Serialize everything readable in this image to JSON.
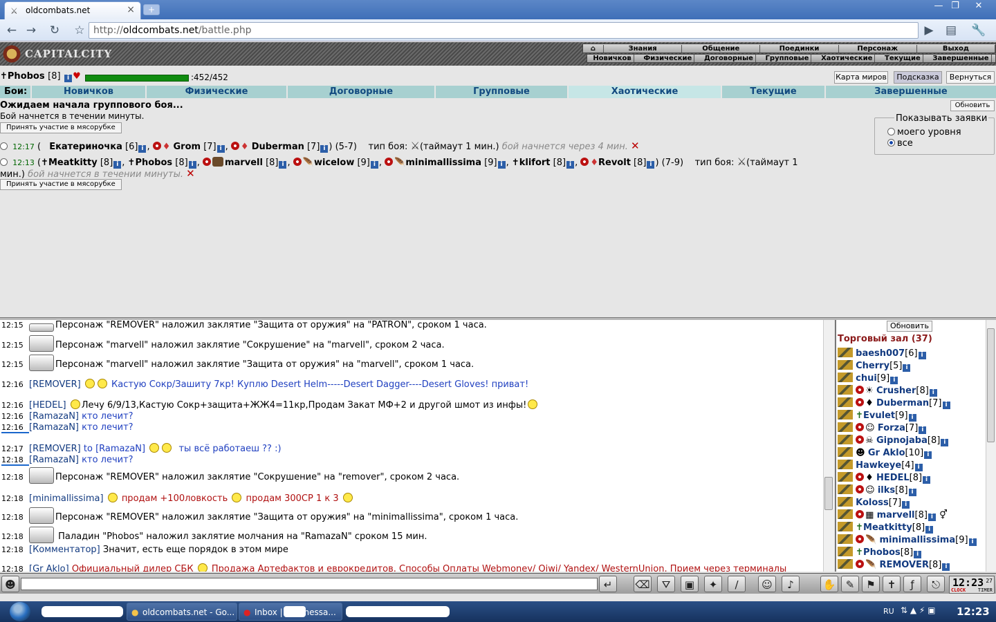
{
  "browser": {
    "tab_title": "oldcombats.net",
    "url_prefix": "http://",
    "url_host": "oldcombats.net",
    "url_path": "/battle.php"
  },
  "game_header": {
    "logo": "CAPITALCITY",
    "menu_top": [
      "Знания",
      "Общение",
      "Поединки",
      "Персонаж",
      "Выход"
    ],
    "menu_sub": [
      "Новичков",
      "Физические",
      "Договорные",
      "Групповые",
      "Хаотические",
      "Текущие",
      "Завершенные"
    ]
  },
  "player": {
    "name": "Phobos",
    "level": "[8]",
    "hp": ":452/452",
    "hp_fraction": 1.0,
    "buttons": [
      "Карта миров",
      "Подсказка",
      "Вернуться"
    ]
  },
  "battle_tabs": {
    "label": "Бои:",
    "tabs": [
      "Новичков",
      "Физические",
      "Договорные",
      "Групповые",
      "Хаотические",
      "Текущие",
      "Завершенные"
    ],
    "active": "Хаотические"
  },
  "battle": {
    "waiting": "Ожидаем начала группового боя...",
    "starts": "Бой начнется в течении минуты.",
    "join_label": "Принять участие в мясорубке",
    "refresh_label": "Обновить",
    "show_title": "Показывать заявки",
    "show_opt1": "моего уровня",
    "show_opt2": "все",
    "row1": {
      "time": "12:17",
      "p1": "Екатериночка",
      "p1l": "[6]",
      "p2": "Grom",
      "p2l": "[7]",
      "p3": "Duberman",
      "p3l": "[7]",
      "range": ") (5-7)",
      "type_label": "тип боя:",
      "timeout": "(таймаут 1 мин.)",
      "starts": "бой начнется через 4 мин."
    },
    "row2": {
      "time": "12:13",
      "players": [
        {
          "name": "Meatkitty",
          "lvl": "[8]"
        },
        {
          "name": "Phobos",
          "lvl": "[8]"
        },
        {
          "name": "marvell",
          "lvl": "[8]"
        },
        {
          "name": "wicelow",
          "lvl": "[9]"
        },
        {
          "name": "minimallissima",
          "lvl": "[9]"
        },
        {
          "name": "klifort",
          "lvl": "[8]"
        },
        {
          "name": "Revolt",
          "lvl": "[8]"
        }
      ],
      "range": ") (7-9)",
      "type_label": "тип боя:",
      "timeout": "(таймаут 1",
      "timeout2": "мин.)",
      "starts": "бой начнется в течении минуты."
    }
  },
  "chat": [
    {
      "t": "12:15",
      "text": "Персонаж \"REMOVER\" наложил заклятие \"Защита от оружия\" на \"PATRON\", сроком 1 часа."
    },
    {
      "t": "12:15",
      "text": "Персонаж \"marvell\" наложил заклятие \"Сокрушение\" на \"marvell\", сроком 2 часа."
    },
    {
      "t": "12:15",
      "text": "Персонаж \"marvell\" наложил заклятие \"Защита от оружия\" на \"marvell\", сроком 1 часа."
    },
    {
      "t": "12:16",
      "nick": "[REMOVER]",
      "text": "Кастую Сокр/Зашиту 7кр! Куплю Desert Helm-----Desert Dagger----Desert Gloves! приват!"
    },
    {
      "t": "12:16",
      "nick": "[HEDEL]",
      "text": "Лечу 6/9/13,Кастую Сокр+защита+ЖЖ4=11кр,Продам Закат МФ+2 и другой шмот из инфы!"
    },
    {
      "t": "12:16",
      "nick": "[RamazaN]",
      "text": "кто лечит?"
    },
    {
      "t": "12:16",
      "nick": "[RamazaN]",
      "text": "кто лечит?"
    },
    {
      "t": "12:17",
      "nick": "[REMOVER]",
      "to": "to [RamazaN]",
      "text": "ты всё работаеш ?? :)"
    },
    {
      "t": "12:18",
      "nick": "[RamazaN]",
      "text": "кто лечит?"
    },
    {
      "t": "12:18",
      "text": "Персонаж \"REMOVER\" наложил заклятие \"Сокрушение\" на \"remover\", сроком 2 часа."
    },
    {
      "t": "12:18",
      "nick": "[minimallissima]",
      "text1": "продам +100ловкость",
      "text2": "продам 300СР 1 к 3"
    },
    {
      "t": "12:18",
      "text": "Персонаж \"REMOVER\" наложил заклятие \"Защита от оружия\" на \"minimallissima\", сроком 1 часа."
    },
    {
      "t": "12:18",
      "text": "Паладин \"Phobos\" наложил заклятие молчания на \"RamazaN\" сроком 15 мин."
    },
    {
      "t": "12:18",
      "nick": "[Комментатор]",
      "text": "Значит, есть еще порядок в этом мире"
    },
    {
      "t": "12:18",
      "nick": "[Gr Aklo]",
      "text1": "Официальный дилер СБК",
      "text2": "Продажа Артефактов и еврокредитов. Способы Оплаты Webmoney/ Qiwi/ Yandex/ WesternUnion. Прием через терминалы"
    }
  ],
  "room": {
    "refresh": "Обновить",
    "title": "Торговый зал (37)",
    "users": [
      {
        "name": "baesh007",
        "lvl": "[6]"
      },
      {
        "name": "Cherry",
        "lvl": "[5]"
      },
      {
        "name": "chui",
        "lvl": "[9]"
      },
      {
        "name": "Crusher",
        "lvl": "[8]"
      },
      {
        "name": "Duberman",
        "lvl": "[7]"
      },
      {
        "name": "Evulet",
        "lvl": "[9]"
      },
      {
        "name": "Forza",
        "lvl": "[7]"
      },
      {
        "name": "Gipnojaba",
        "lvl": "[8]"
      },
      {
        "name": "Gr Aklo",
        "lvl": "[10]"
      },
      {
        "name": "Hawkeye",
        "lvl": "[4]"
      },
      {
        "name": "HEDEL",
        "lvl": "[8]"
      },
      {
        "name": "ilks",
        "lvl": "[8]"
      },
      {
        "name": "Koloss",
        "lvl": "[7]"
      },
      {
        "name": "marvell",
        "lvl": "[8]"
      },
      {
        "name": "Meatkitty",
        "lvl": "[8]"
      },
      {
        "name": "minimallissima",
        "lvl": "[9]"
      },
      {
        "name": "Phobos",
        "lvl": "[8]"
      },
      {
        "name": "REMOVER",
        "lvl": "[8]"
      }
    ]
  },
  "bottom": {
    "clock": "12:23",
    "clock_sec": "27",
    "clock_label": "CLOCK",
    "timer_label": "TIMER"
  },
  "taskbar": {
    "items": [
      "oldcombats.net - Go...",
      "Inbox |",
      "messa..."
    ],
    "lang": "RU",
    "time": "12:23"
  },
  "colors": {
    "accent": "#a7d0d0",
    "hp": "#108c10",
    "nick": "#123a80"
  }
}
